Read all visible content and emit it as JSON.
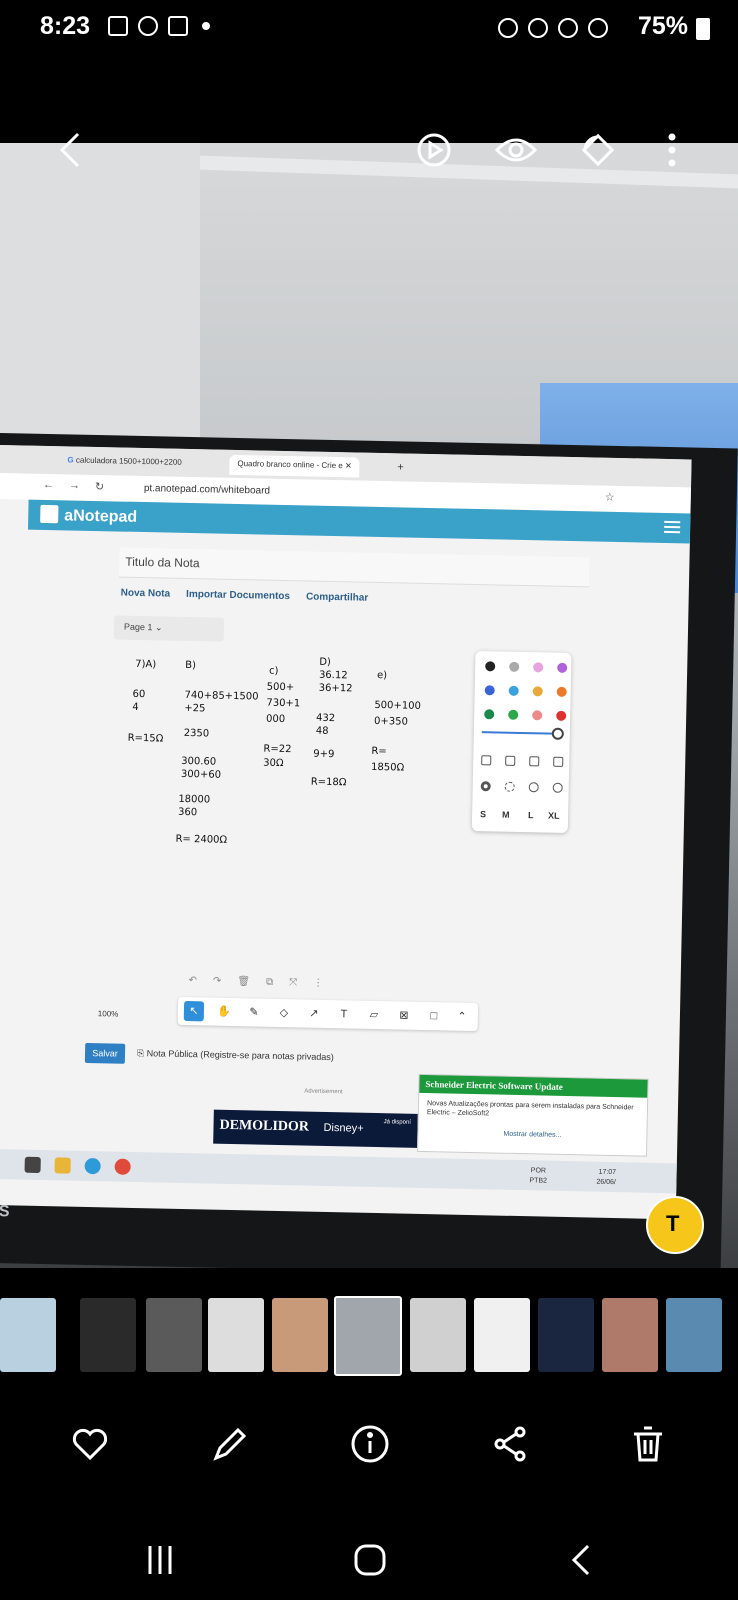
{
  "status_bar": {
    "time": "8:23",
    "battery": "75%"
  },
  "browser": {
    "tab1": "calculadora 1500+1000+2200",
    "tab2": "Quadro branco online - Crie e",
    "url": "pt.anotepad.com/whiteboard"
  },
  "app": {
    "name": "aNotepad",
    "note_title_placeholder": "Titulo da Nota",
    "new_note": "Nova Nota",
    "import": "Importar Documentos",
    "share": "Compartilhar",
    "page": "Page 1",
    "zoom": "100%",
    "save": "Salvar",
    "public_note": "Nota Pública (Registre-se para notas privadas)",
    "sizes": [
      "S",
      "M",
      "L",
      "XL"
    ]
  },
  "whiteboard": {
    "a_label": "7)A)",
    "a_line1": "60",
    "a_line2": "4",
    "a_result": "R=15Ω",
    "b_label": "B)",
    "b_line1": "740+85+1500",
    "b_line2": "+25",
    "b_line3": "2350",
    "b_line4": "300.60",
    "b_line5": "300+60",
    "b_line6": "18000",
    "b_line7": "360",
    "b_result": "R= 2400Ω",
    "c_label": "c)",
    "c_line1": "500+",
    "c_line2": "730+1",
    "c_line3": "000",
    "c_result1": "R=22",
    "c_result2": "30Ω",
    "d_label": "D)",
    "d_line1": "36.12",
    "d_line2": "36+12",
    "d_line3": "432",
    "d_line4": "48",
    "d_line5": "9+9",
    "d_result": "R=18Ω",
    "e_label": "e)",
    "e_line1": "500+100",
    "e_line2": "0+350",
    "e_result1": "R=",
    "e_result2": "1850Ω"
  },
  "notification": {
    "title": "Schneider Electric Software Update",
    "body": "Novas Atualizações prontas para serem instaladas para Schneider Electric – ZelioSoft2",
    "link": "Mostrar detalhes..."
  },
  "ad": {
    "label": "Advertisement",
    "title": "DEMOLIDOR",
    "brand": "Disney+",
    "cta": "Já disponí"
  },
  "taskbar": {
    "lang1": "POR",
    "lang2": "PTB2",
    "time": "17:07",
    "date": "26/06/"
  },
  "monitor_brand": "IPS",
  "colors": {
    "app_header": "#3aa1c9",
    "notify_header": "#1c9a3b",
    "lens": "#f6c71a"
  }
}
